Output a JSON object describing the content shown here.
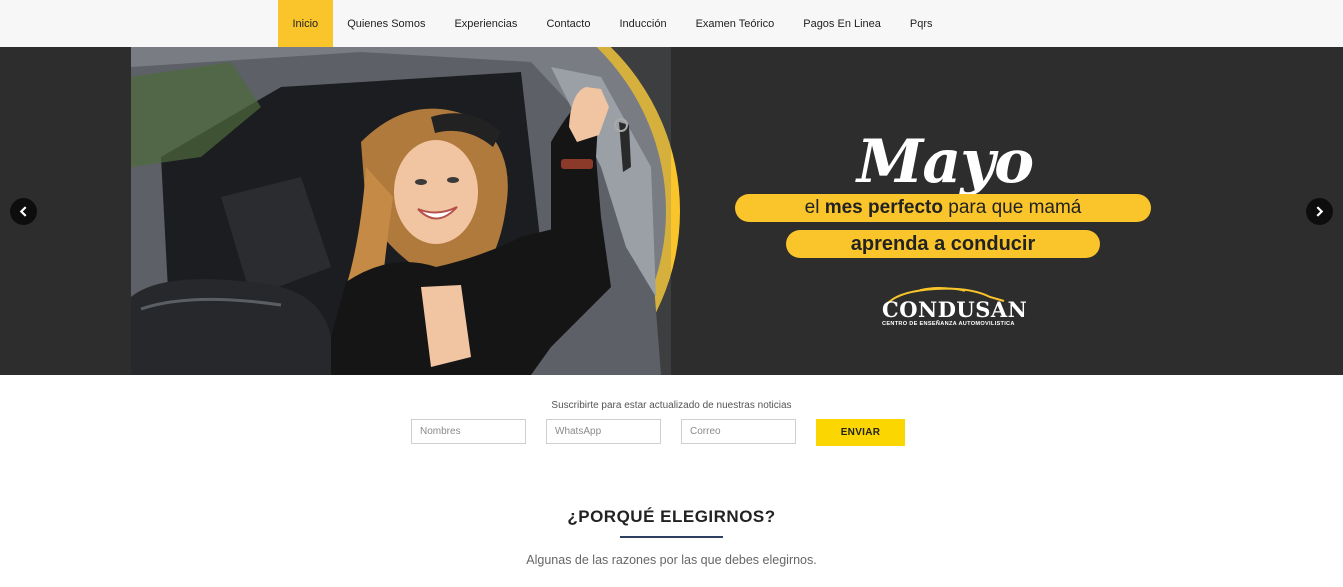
{
  "nav": {
    "items": [
      {
        "label": "Inicio",
        "active": true
      },
      {
        "label": "Quienes Somos"
      },
      {
        "label": "Experiencias"
      },
      {
        "label": "Contacto"
      },
      {
        "label": "Inducción"
      },
      {
        "label": "Examen Teórico"
      },
      {
        "label": "Pagos En Linea"
      },
      {
        "label": "Pqrs"
      }
    ]
  },
  "hero": {
    "month": "Mayo",
    "line1_prefix": "el ",
    "line1_bold": "mes perfecto",
    "line1_suffix": " para que mamá",
    "line2": "aprenda a conducir",
    "brand_name": "CONDUSAN",
    "brand_tagline": "CENTRO DE ENSEÑANZA AUTOMOVILISTICA",
    "prev_icon": "chevron-left-icon",
    "next_icon": "chevron-right-icon",
    "colors": {
      "accent": "#f9c52a",
      "background": "#2d2d2d"
    }
  },
  "subscribe": {
    "title": "Suscribirte para estar actualizado de nuestras noticias",
    "name_placeholder": "Nombres",
    "whatsapp_placeholder": "WhatsApp",
    "email_placeholder": "Correo",
    "submit_label": "ENVIAR",
    "button_color": "#fcd600"
  },
  "why": {
    "title": "¿PORQUÉ ELEGIRNOS?",
    "subtitle": "Algunas de las razones por las que debes elegirnos."
  }
}
